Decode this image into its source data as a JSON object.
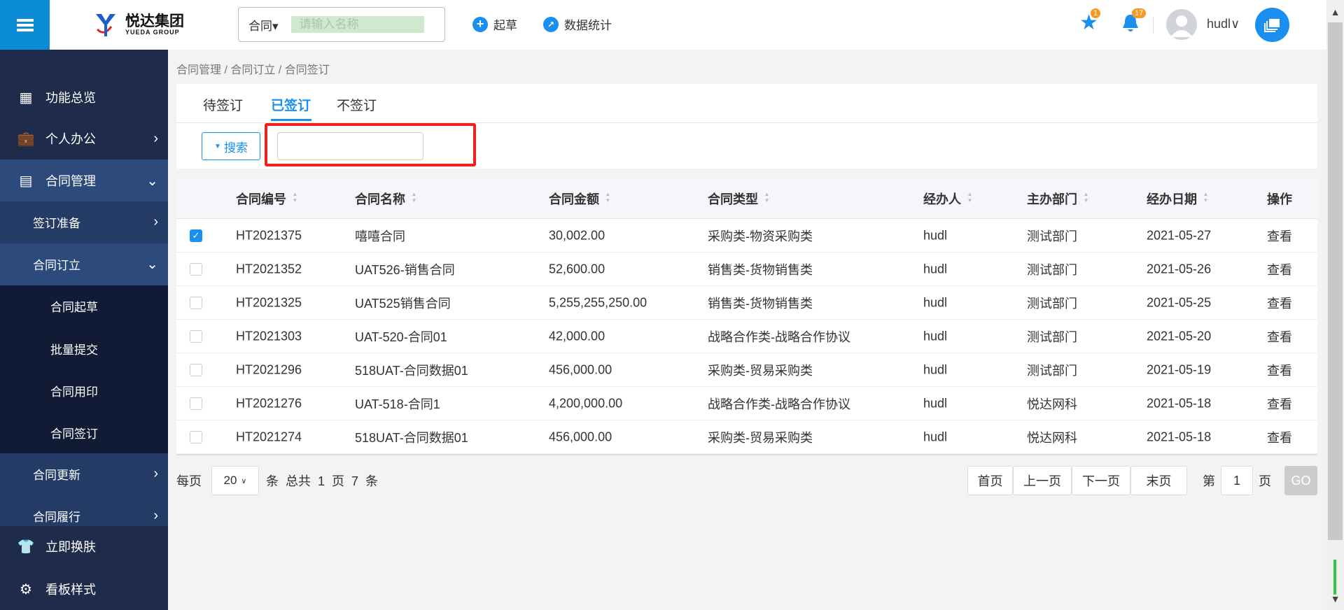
{
  "header": {
    "logo_text": "悦达集团",
    "logo_sub": "YUEDA GROUP",
    "search_type": "合同▾",
    "search_placeholder": "请输入名称",
    "draft_label": "起草",
    "stats_label": "数据统计",
    "favorites_count": "1",
    "notifications_count": "17",
    "username": "hudl"
  },
  "sidebar": {
    "items": [
      {
        "label": "功能总览"
      },
      {
        "label": "个人办公"
      },
      {
        "label": "合同管理"
      },
      {
        "label": "签订准备"
      },
      {
        "label": "合同订立"
      },
      {
        "label": "合同起草"
      },
      {
        "label": "批量提交"
      },
      {
        "label": "合同用印"
      },
      {
        "label": "合同签订"
      },
      {
        "label": "合同更新"
      },
      {
        "label": "合同履行"
      },
      {
        "label": "立即换肤"
      },
      {
        "label": "看板样式"
      }
    ]
  },
  "breadcrumb": "合同管理 / 合同订立 / 合同签订",
  "tabs": [
    {
      "label": "待签订"
    },
    {
      "label": "已签订"
    },
    {
      "label": "不签订"
    }
  ],
  "search_button": "搜索",
  "table": {
    "headers": [
      "合同编号",
      "合同名称",
      "合同金额",
      "合同类型",
      "经办人",
      "主办部门",
      "经办日期",
      "操作"
    ],
    "rows": [
      [
        "HT2021375",
        "嘻嘻合同",
        "30,002.00",
        "采购类-物资采购类",
        "hudl",
        "测试部门",
        "2021-05-27",
        "查看"
      ],
      [
        "HT2021352",
        "UAT526-销售合同",
        "52,600.00",
        "销售类-货物销售类",
        "hudl",
        "测试部门",
        "2021-05-26",
        "查看"
      ],
      [
        "HT2021325",
        "UAT525销售合同",
        "5,255,255,250.00",
        "销售类-货物销售类",
        "hudl",
        "测试部门",
        "2021-05-25",
        "查看"
      ],
      [
        "HT2021303",
        "UAT-520-合同01",
        "42,000.00",
        "战略合作类-战略合作协议",
        "hudl",
        "测试部门",
        "2021-05-20",
        "查看"
      ],
      [
        "HT2021296",
        "518UAT-合同数据01",
        "456,000.00",
        "采购类-贸易采购类",
        "hudl",
        "测试部门",
        "2021-05-19",
        "查看"
      ],
      [
        "HT2021276",
        "UAT-518-合同1",
        "4,200,000.00",
        "战略合作类-战略合作协议",
        "hudl",
        "悦达网科",
        "2021-05-18",
        "查看"
      ],
      [
        "HT2021274",
        "518UAT-合同数据01",
        "456,000.00",
        "采购类-贸易采购类",
        "hudl",
        "悦达网科",
        "2021-05-18",
        "查看"
      ]
    ],
    "checked": [
      true,
      false,
      false,
      false,
      false,
      false,
      false
    ]
  },
  "pager": {
    "per_page_label": "每页",
    "per_page": "20",
    "summary": "条  总共  1  页  7  条",
    "first": "首页",
    "prev": "上一页",
    "next": "下一页",
    "last": "末页",
    "page_prefix": "第",
    "page": "1",
    "page_suffix": "页",
    "go": "GO"
  }
}
